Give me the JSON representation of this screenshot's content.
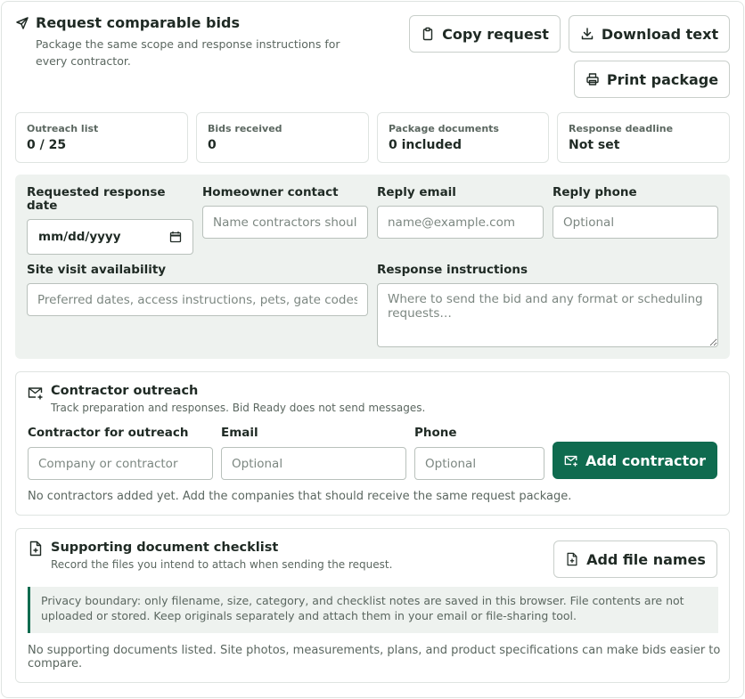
{
  "header": {
    "title": "Request comparable bids",
    "subtitle": "Package the same scope and response instructions for every contractor.",
    "copy_label": "Copy request",
    "download_label": "Download text",
    "print_label": "Print package"
  },
  "stats": [
    {
      "label": "Outreach list",
      "value": "0 / 25"
    },
    {
      "label": "Bids received",
      "value": "0"
    },
    {
      "label": "Package documents",
      "value": "0 included"
    },
    {
      "label": "Response deadline",
      "value": "Not set"
    }
  ],
  "form": {
    "response_date_label": "Requested response date",
    "response_date_value": "mm/dd/yyyy",
    "homeowner_label": "Homeowner contact",
    "homeowner_placeholder": "Name contractors should address",
    "reply_email_label": "Reply email",
    "reply_email_placeholder": "name@example.com",
    "reply_phone_label": "Reply phone",
    "reply_phone_placeholder": "Optional",
    "site_visit_label": "Site visit availability",
    "site_visit_placeholder": "Preferred dates, access instructions, pets, gate codes",
    "instructions_label": "Response instructions",
    "instructions_placeholder": "Where to send the bid and any format or scheduling requests…"
  },
  "outreach": {
    "title": "Contractor outreach",
    "subtitle": "Track preparation and responses. Bid Ready does not send messages.",
    "contractor_label": "Contractor for outreach",
    "contractor_placeholder": "Company or contractor",
    "email_label": "Email",
    "email_placeholder": "Optional",
    "phone_label": "Phone",
    "phone_placeholder": "Optional",
    "add_label": "Add contractor",
    "empty_text": "No contractors added yet. Add the companies that should receive the same request package."
  },
  "documents": {
    "title": "Supporting document checklist",
    "subtitle": "Record the files you intend to attach when sending the request.",
    "add_label": "Add file names",
    "privacy_notice": "Privacy boundary: only filename, size, category, and checklist notes are saved in this browser. File contents are not uploaded or stored. Keep originals separately and attach them in your email or file-sharing tool.",
    "empty_text": "No supporting documents listed. Site photos, measurements, plans, and product specifications can make bids easier to compare."
  },
  "colors": {
    "primary": "#0f6b4f",
    "panel": "#eef2ef",
    "border": "#dfe4e1",
    "muted_text": "#5b6760"
  }
}
